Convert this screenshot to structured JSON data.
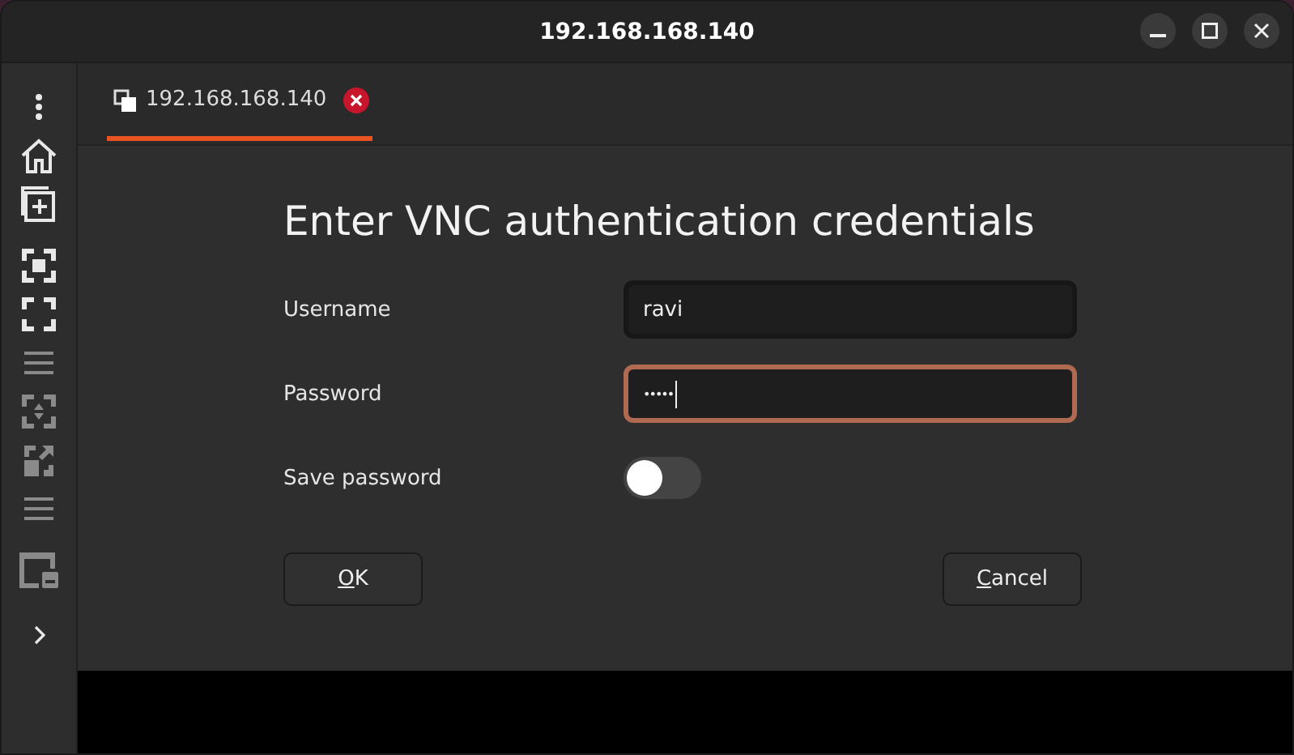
{
  "window": {
    "title": "192.168.168.140"
  },
  "sidebar": {
    "items": [
      {
        "kind": "more",
        "disabled": false
      },
      {
        "kind": "home",
        "disabled": false
      },
      {
        "kind": "new",
        "disabled": false
      },
      {
        "kind": "fit",
        "disabled": false
      },
      {
        "kind": "fullscreen",
        "disabled": false
      },
      {
        "kind": "lines",
        "disabled": true
      },
      {
        "kind": "scale",
        "disabled": true
      },
      {
        "kind": "expand",
        "disabled": true
      },
      {
        "kind": "lines",
        "disabled": true
      },
      {
        "kind": "window",
        "disabled": true
      },
      {
        "kind": "chevron",
        "disabled": false
      }
    ]
  },
  "tabs": [
    {
      "label": "192.168.168.140",
      "selected": true
    }
  ],
  "dialog": {
    "heading": "Enter VNC authentication credentials",
    "fields": [
      {
        "kind": "text",
        "label": "Username",
        "value": "ravi",
        "focused": false
      },
      {
        "kind": "password",
        "label": "Password",
        "value": "•••••",
        "focused": true
      },
      {
        "kind": "switch",
        "label": "Save password",
        "on": false
      }
    ],
    "buttons": [
      {
        "mnemonic": "O",
        "rest": "K"
      },
      {
        "mnemonic": "C",
        "rest": "ancel"
      }
    ]
  }
}
